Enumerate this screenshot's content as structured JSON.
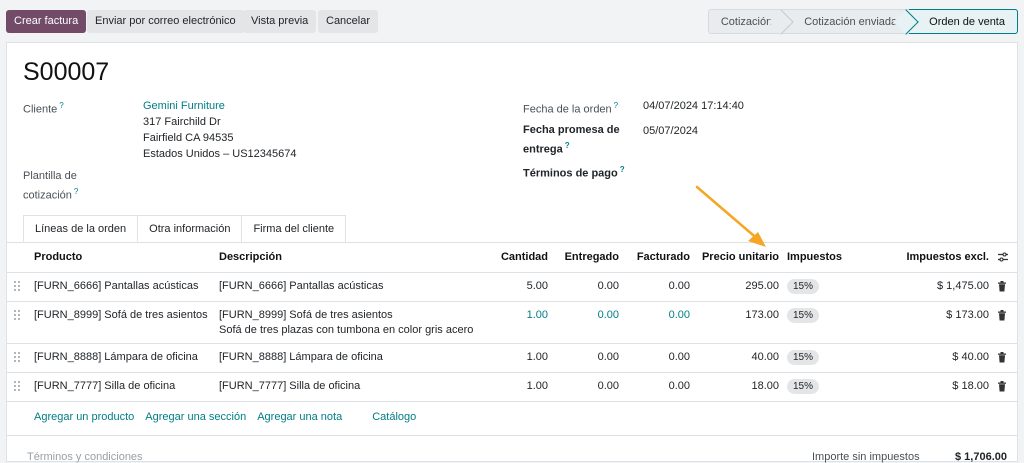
{
  "actions": {
    "create_invoice": "Crear factura",
    "send_email": "Enviar por correo electrónico",
    "preview": "Vista previa",
    "cancel": "Cancelar"
  },
  "statusbar": {
    "steps": [
      "Cotización",
      "Cotización enviada",
      "Orden de venta"
    ],
    "active": "Orden de venta"
  },
  "order": {
    "name": "S00007",
    "customer_label": "Cliente",
    "customer_name": "Gemini Furniture",
    "address_line1": "317 Fairchild Dr",
    "address_line2": "Fairfield CA 94535",
    "address_line3": "Estados Unidos – US12345674",
    "template_label_1": "Plantilla de",
    "template_label_2": "cotización",
    "order_date_label": "Fecha de la orden",
    "order_date": "04/07/2024 17:14:40",
    "commitment_label_1": "Fecha promesa de",
    "commitment_label_2": "entrega",
    "commitment_date": "05/07/2024",
    "payment_terms_label": "Términos de pago"
  },
  "tabs": [
    "Líneas de la orden",
    "Otra información",
    "Firma del cliente"
  ],
  "table": {
    "headers": {
      "product": "Producto",
      "description": "Descripción",
      "quantity": "Cantidad",
      "delivered": "Entregado",
      "invoiced": "Facturado",
      "unit_price": "Precio unitario",
      "taxes": "Impuestos",
      "subtotal": "Impuestos excl."
    },
    "rows": [
      {
        "product": "[FURN_6666] Pantallas acústicas",
        "description": "[FURN_6666] Pantallas acústicas",
        "description2": "",
        "quantity": "5.00",
        "delivered": "0.00",
        "invoiced": "0.00",
        "unit_price": "295.00",
        "tax": "15%",
        "subtotal": "$ 1,475.00"
      },
      {
        "product": "[FURN_8999] Sofá de tres asientos",
        "description": "[FURN_8999] Sofá de tres asientos",
        "description2": "Sofá de tres plazas con tumbona en color gris acero",
        "quantity": "1.00",
        "delivered": "0.00",
        "invoiced": "0.00",
        "unit_price": "173.00",
        "tax": "15%",
        "subtotal": "$ 173.00"
      },
      {
        "product": "[FURN_8888] Lámpara de oficina",
        "description": "[FURN_8888] Lámpara de oficina",
        "description2": "",
        "quantity": "1.00",
        "delivered": "0.00",
        "invoiced": "0.00",
        "unit_price": "40.00",
        "tax": "15%",
        "subtotal": "$ 40.00"
      },
      {
        "product": "[FURN_7777] Silla de oficina",
        "description": "[FURN_7777] Silla de oficina",
        "description2": "",
        "quantity": "1.00",
        "delivered": "0.00",
        "invoiced": "0.00",
        "unit_price": "18.00",
        "tax": "15%",
        "subtotal": "$ 18.00"
      }
    ]
  },
  "add_links": {
    "product": "Agregar un producto",
    "section": "Agregar una sección",
    "note": "Agregar una nota",
    "catalog": "Catálogo"
  },
  "footer": {
    "terms": "Términos y condiciones",
    "untaxed_label": "Importe sin impuestos",
    "untaxed_value": "$ 1,706.00"
  },
  "colors": {
    "primary": "#714b67",
    "link": "#017e84",
    "annotation_arrow": "#f5a623"
  }
}
